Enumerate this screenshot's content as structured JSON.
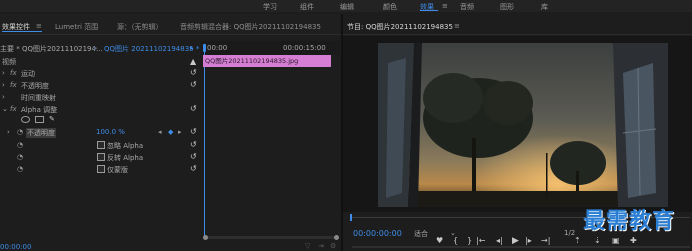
{
  "workspaces": [
    "学习",
    "组件",
    "编辑",
    "颜色",
    "效果",
    "音频",
    "图形",
    "库"
  ],
  "workspace_active": "效果",
  "workspace_menu": "≡",
  "left_tabs": {
    "effect_controls": "效果控件",
    "menu": "≡",
    "lumetri": "Lumetri 范围",
    "source": "源：（无剪辑）",
    "audio_mixer": "音频剪辑混合器: QQ图片20211102194835"
  },
  "clip_select": "主要 * QQ图片20211102194...",
  "clip_select_active": "QQ图片 20211102194835 *",
  "clip_arrow": "▸",
  "time_start": "00:00",
  "time_end": "00:00:15:00",
  "timeline_clip": "QQ图片20211102194835.jpg",
  "section_video": "视频",
  "effects": [
    {
      "fx": "fx",
      "label": "运动"
    },
    {
      "fx": "fx",
      "label": "不透明度"
    },
    {
      "fx": "",
      "label": "时间重映射"
    },
    {
      "fx": "fx",
      "label": "Alpha 调整"
    }
  ],
  "opacity_label": "不透明度",
  "opacity_value": "100.0 %",
  "options": [
    "忽略 Alpha",
    "反转 Alpha",
    "仅蒙版"
  ],
  "bottom_timecode": "00:00:00",
  "program_title": "节目: QQ图片20211102194835",
  "program_menu": "≡",
  "program_timecode": "00:00:00:00",
  "fit_label": "适合",
  "quality": "1/2",
  "watermark": "最需教育"
}
